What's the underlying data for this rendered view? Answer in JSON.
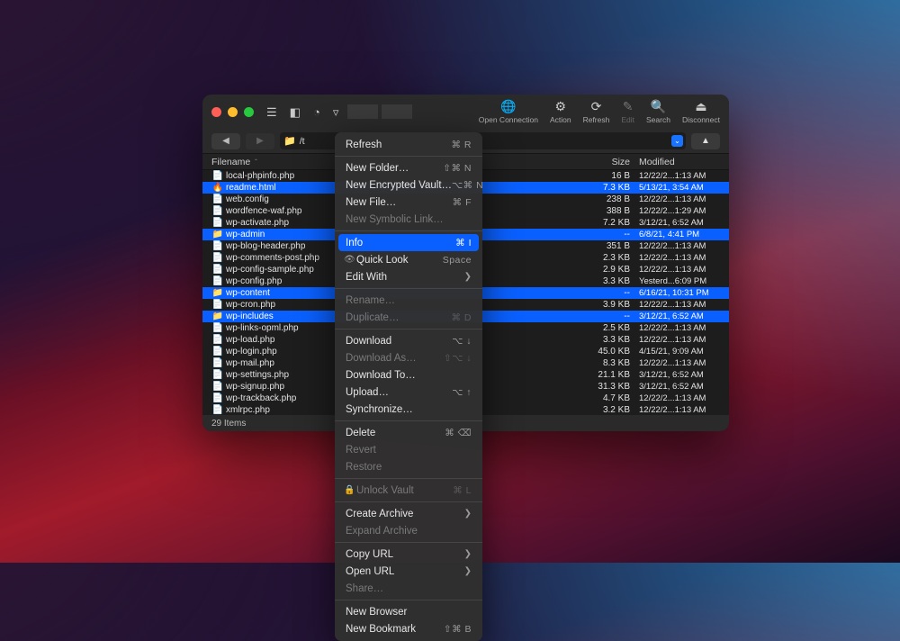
{
  "traffic_colors": {
    "close": "#ff5f56",
    "min": "#ffbd2e",
    "max": "#27c93f"
  },
  "toolbar": {
    "open": "Open Connection",
    "action": "Action",
    "refresh": "Refresh",
    "edit": "Edit",
    "search": "Search",
    "disconnect": "Disconnect"
  },
  "nav": {
    "path": "/t",
    "back": "◀",
    "fwd": "▶",
    "up": "▲"
  },
  "columns": {
    "name": "Filename",
    "size": "Size",
    "modified": "Modified",
    "sort": "ˆ"
  },
  "status": "29 Items",
  "files": [
    {
      "ico": "file",
      "name": "local-phpinfo.php",
      "size": "16 B",
      "mod": "12/22/2...1:13 AM",
      "sel": false
    },
    {
      "ico": "html",
      "name": "readme.html",
      "size": "7.3 KB",
      "mod": "5/13/21, 3:54 AM",
      "sel": true
    },
    {
      "ico": "file",
      "name": "web.config",
      "size": "238 B",
      "mod": "12/22/2...1:13 AM",
      "sel": false
    },
    {
      "ico": "file",
      "name": "wordfence-waf.php",
      "size": "388 B",
      "mod": "12/22/2...1:29 AM",
      "sel": false
    },
    {
      "ico": "file",
      "name": "wp-activate.php",
      "size": "7.2 KB",
      "mod": "3/12/21, 6:52 AM",
      "sel": false
    },
    {
      "ico": "folder",
      "name": "wp-admin",
      "size": "--",
      "mod": "6/8/21, 4:41 PM",
      "sel": true
    },
    {
      "ico": "file",
      "name": "wp-blog-header.php",
      "size": "351 B",
      "mod": "12/22/2...1:13 AM",
      "sel": false
    },
    {
      "ico": "file",
      "name": "wp-comments-post.php",
      "size": "2.3 KB",
      "mod": "12/22/2...1:13 AM",
      "sel": false
    },
    {
      "ico": "file",
      "name": "wp-config-sample.php",
      "size": "2.9 KB",
      "mod": "12/22/2...1:13 AM",
      "sel": false
    },
    {
      "ico": "file",
      "name": "wp-config.php",
      "size": "3.3 KB",
      "mod": "Yesterd...6:09 PM",
      "sel": false
    },
    {
      "ico": "folder",
      "name": "wp-content",
      "size": "--",
      "mod": "6/16/21, 10:31 PM",
      "sel": true
    },
    {
      "ico": "file",
      "name": "wp-cron.php",
      "size": "3.9 KB",
      "mod": "12/22/2...1:13 AM",
      "sel": false
    },
    {
      "ico": "folder",
      "name": "wp-includes",
      "size": "--",
      "mod": "3/12/21, 6:52 AM",
      "sel": true
    },
    {
      "ico": "file",
      "name": "wp-links-opml.php",
      "size": "2.5 KB",
      "mod": "12/22/2...1:13 AM",
      "sel": false
    },
    {
      "ico": "file",
      "name": "wp-load.php",
      "size": "3.3 KB",
      "mod": "12/22/2...1:13 AM",
      "sel": false
    },
    {
      "ico": "file",
      "name": "wp-login.php",
      "size": "45.0 KB",
      "mod": "4/15/21, 9:09 AM",
      "sel": false
    },
    {
      "ico": "file",
      "name": "wp-mail.php",
      "size": "8.3 KB",
      "mod": "12/22/2...1:13 AM",
      "sel": false
    },
    {
      "ico": "file",
      "name": "wp-settings.php",
      "size": "21.1 KB",
      "mod": "3/12/21, 6:52 AM",
      "sel": false
    },
    {
      "ico": "file",
      "name": "wp-signup.php",
      "size": "31.3 KB",
      "mod": "3/12/21, 6:52 AM",
      "sel": false
    },
    {
      "ico": "file",
      "name": "wp-trackback.php",
      "size": "4.7 KB",
      "mod": "12/22/2...1:13 AM",
      "sel": false
    },
    {
      "ico": "file",
      "name": "xmlrpc.php",
      "size": "3.2 KB",
      "mod": "12/22/2...1:13 AM",
      "sel": false
    }
  ],
  "menu": [
    {
      "t": "item",
      "label": "Refresh",
      "sc": "⌘ R"
    },
    {
      "t": "sep"
    },
    {
      "t": "item",
      "label": "New Folder…",
      "sc": "⇧⌘ N"
    },
    {
      "t": "item",
      "label": "New Encrypted Vault…",
      "sc": "⌥⌘ N"
    },
    {
      "t": "item",
      "label": "New File…",
      "sc": "⌘ F"
    },
    {
      "t": "item",
      "label": "New Symbolic Link…",
      "disabled": true
    },
    {
      "t": "sep"
    },
    {
      "t": "item",
      "label": "Info",
      "sc": "⌘ I",
      "hl": true
    },
    {
      "t": "item",
      "label": "Quick Look",
      "sc": "Space",
      "pre": "eye"
    },
    {
      "t": "item",
      "label": "Edit With",
      "sub": true
    },
    {
      "t": "sep"
    },
    {
      "t": "item",
      "label": "Rename…",
      "disabled": true
    },
    {
      "t": "item",
      "label": "Duplicate…",
      "sc": "⌘ D",
      "disabled": true
    },
    {
      "t": "sep"
    },
    {
      "t": "item",
      "label": "Download",
      "sc": "⌥ ↓"
    },
    {
      "t": "item",
      "label": "Download As…",
      "sc": "⇧⌥ ↓",
      "disabled": true
    },
    {
      "t": "item",
      "label": "Download To…"
    },
    {
      "t": "item",
      "label": "Upload…",
      "sc": "⌥ ↑"
    },
    {
      "t": "item",
      "label": "Synchronize…"
    },
    {
      "t": "sep"
    },
    {
      "t": "item",
      "label": "Delete",
      "sc": "⌘ ⌫"
    },
    {
      "t": "item",
      "label": "Revert",
      "disabled": true
    },
    {
      "t": "item",
      "label": "Restore",
      "disabled": true
    },
    {
      "t": "sep"
    },
    {
      "t": "item",
      "label": "Unlock Vault",
      "sc": "⌘ L",
      "disabled": true,
      "pre": "lock"
    },
    {
      "t": "sep"
    },
    {
      "t": "item",
      "label": "Create Archive",
      "sub": true
    },
    {
      "t": "item",
      "label": "Expand Archive",
      "disabled": true
    },
    {
      "t": "sep"
    },
    {
      "t": "item",
      "label": "Copy URL",
      "sub": true
    },
    {
      "t": "item",
      "label": "Open URL",
      "sub": true
    },
    {
      "t": "item",
      "label": "Share…",
      "disabled": true
    },
    {
      "t": "sep"
    },
    {
      "t": "item",
      "label": "New Browser"
    },
    {
      "t": "item",
      "label": "New Bookmark",
      "sc": "⇧⌘ B"
    }
  ]
}
